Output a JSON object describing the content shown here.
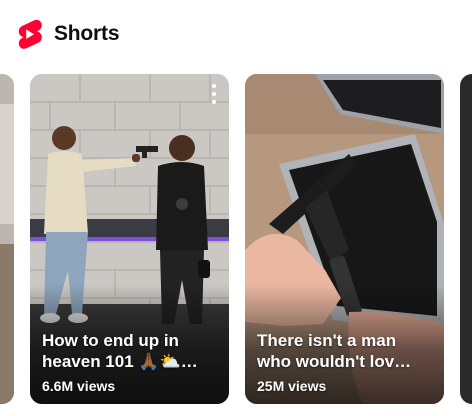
{
  "header": {
    "logo_icon": "youtube-shorts-icon",
    "title": "Shorts",
    "brand_color": "#ff0033"
  },
  "shelf": {
    "items": [
      {
        "title": "How to end up in\nheaven 101 🙏🏾⛅…",
        "views": "6.6M views",
        "menu_icon": "more-vert-icon"
      },
      {
        "title": "There isn't a man\nwho wouldn't lov…",
        "views": "25M views",
        "menu_icon": "more-vert-icon"
      }
    ]
  }
}
